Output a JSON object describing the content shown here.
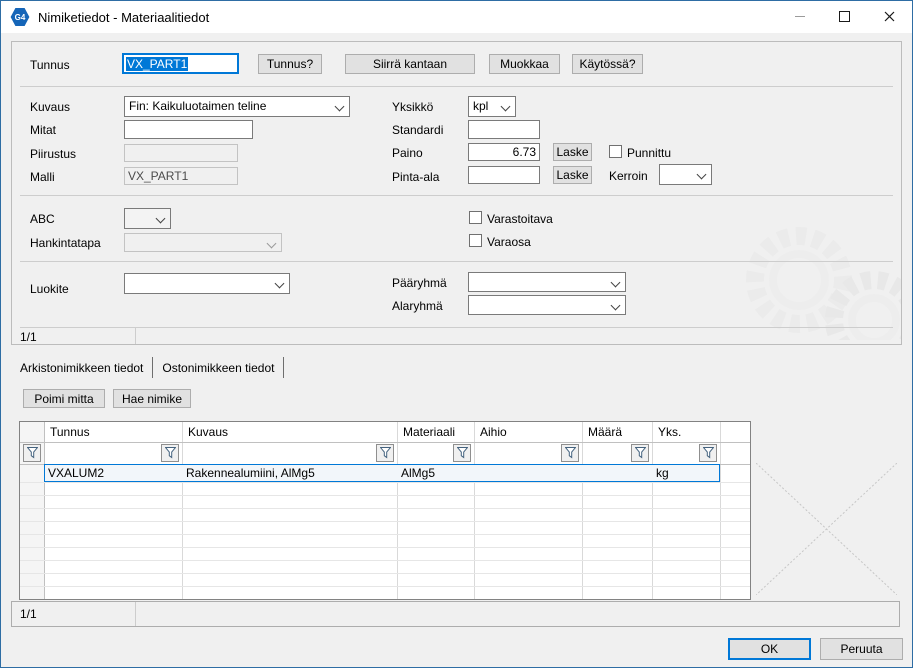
{
  "window": {
    "title": "Nimiketiedot - Materiaalitiedot",
    "icon_label": "G4"
  },
  "form": {
    "tunnus_label": "Tunnus",
    "tunnus_value": "VX_PART1",
    "btn_tunnus": "Tunnus?",
    "btn_siirra": "Siirrä kantaan",
    "btn_muokkaa": "Muokkaa",
    "btn_kaytossa": "Käytössä?",
    "kuvaus_label": "Kuvaus",
    "kuvaus_value": "Fin: Kaikuluotaimen teline",
    "mitat_label": "Mitat",
    "mitat_value": "",
    "piirustus_label": "Piirustus",
    "piirustus_value": "",
    "malli_label": "Malli",
    "malli_value": "VX_PART1",
    "yksikko_label": "Yksikkö",
    "yksikko_value": "kpl",
    "standardi_label": "Standardi",
    "standardi_value": "",
    "paino_label": "Paino",
    "paino_value": "6.73",
    "laske_label": "Laske",
    "punnittu_label": "Punnittu",
    "pinta_ala_label": "Pinta-ala",
    "pinta_ala_value": "",
    "kerroin_label": "Kerroin",
    "kerroin_value": "",
    "abc_label": "ABC",
    "abc_value": "",
    "hankintatapa_label": "Hankintatapa",
    "hankintatapa_value": "",
    "varastoitava_label": "Varastoitava",
    "varaosa_label": "Varaosa",
    "luokite_label": "Luokite",
    "luokite_value": "",
    "paaryhma_label": "Pääryhmä",
    "paaryhma_value": "",
    "alaryhma_label": "Alaryhmä",
    "alaryhma_value": "",
    "pager": "1/1"
  },
  "tabs": [
    {
      "label": "Arkistonimikkeen tiedot",
      "active": true
    },
    {
      "label": "Ostonimikkeen tiedot",
      "active": false
    }
  ],
  "actions": {
    "poimi_mitta": "Poimi mitta",
    "hae_nimike": "Hae nimike"
  },
  "table": {
    "columns": [
      "Tunnus",
      "Kuvaus",
      "Materiaali",
      "Aihio",
      "Määrä",
      "Yks."
    ],
    "rows": [
      {
        "tunnus": "VXALUM2",
        "kuvaus": "Rakennealumiini, AlMg5",
        "materiaali": "AlMg5",
        "aihio": "",
        "maara": "",
        "yks": "kg"
      }
    ],
    "pager": "1/1"
  },
  "footer": {
    "ok": "OK",
    "peruuta": "Peruuta"
  },
  "colors": {
    "accent": "#0078d7",
    "selection": "#0078d7",
    "window_border": "#2e6da4"
  }
}
